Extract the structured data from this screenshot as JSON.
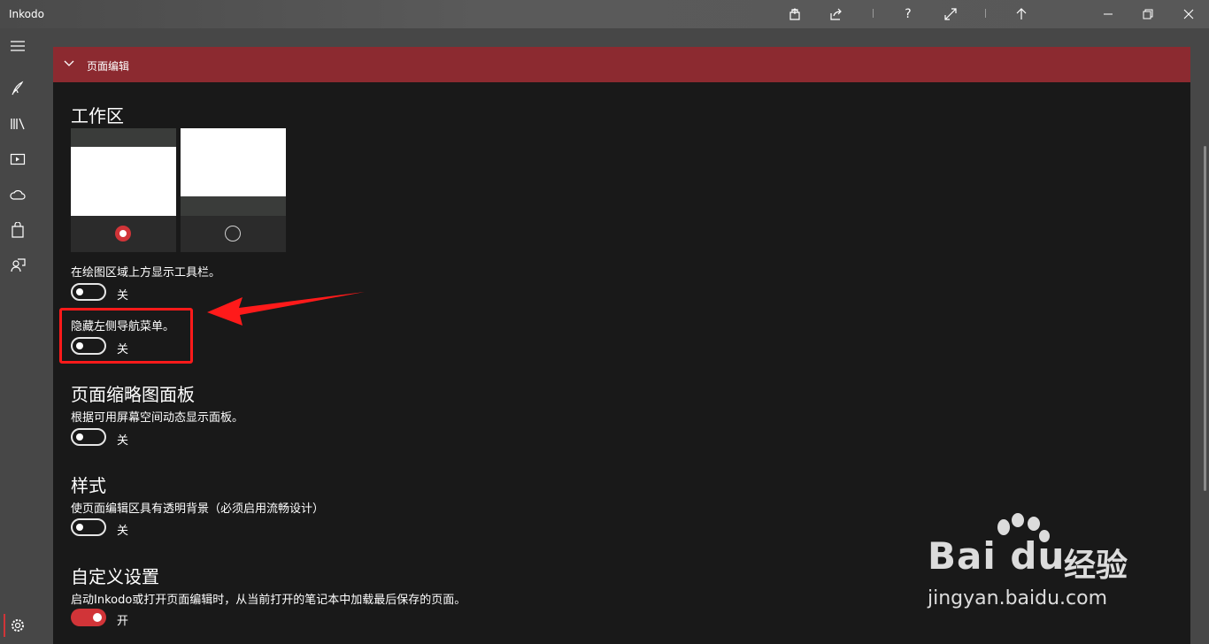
{
  "app": {
    "title": "Inkodo"
  },
  "titlebar": {
    "icons": [
      "export-icon",
      "share-icon",
      "help-icon",
      "fullscreen-icon",
      "pin-top-icon"
    ],
    "help_glyph": "?",
    "window_controls": [
      "minimize-icon",
      "restore-icon",
      "close-icon"
    ]
  },
  "rail": {
    "items": [
      "hamburger-menu-icon",
      "pen-icon",
      "library-icon",
      "slideshow-icon",
      "cloud-icon",
      "store-bag-icon",
      "feedback-icon",
      "settings-icon"
    ]
  },
  "section": {
    "title": "页面编辑",
    "expanded": true
  },
  "workspace": {
    "heading": "工作区",
    "layouts": [
      {
        "name": "toolbar-top-layout",
        "selected": true
      },
      {
        "name": "toolbar-bottom-layout",
        "selected": false
      }
    ],
    "settings": [
      {
        "label": "在绘图区域上方显示工具栏。",
        "state": "关",
        "on": false
      },
      {
        "label": "隐藏左侧导航菜单。",
        "state": "关",
        "on": false
      }
    ]
  },
  "thumbnail_panel": {
    "heading": "页面缩略图面板",
    "label": "根据可用屏幕空间动态显示面板。",
    "state": "关",
    "on": false
  },
  "style": {
    "heading": "样式",
    "label": "使页面编辑区具有透明背景（必须启用流畅设计）",
    "state": "关",
    "on": false
  },
  "custom": {
    "heading": "自定义设置",
    "label": "启动Inkodo或打开页面编辑时，从当前打开的笔记本中加载最后保存的页面。",
    "state": "开",
    "on": true
  },
  "watermark": {
    "logo": "Bai du",
    "cn": "经验",
    "url": "jingyan.baidu.com"
  },
  "colors": {
    "accent": "#d13438",
    "header": "#8c2a30",
    "panel": "#191919",
    "chrome": "#474747",
    "annotation": "#ff1a1a"
  }
}
